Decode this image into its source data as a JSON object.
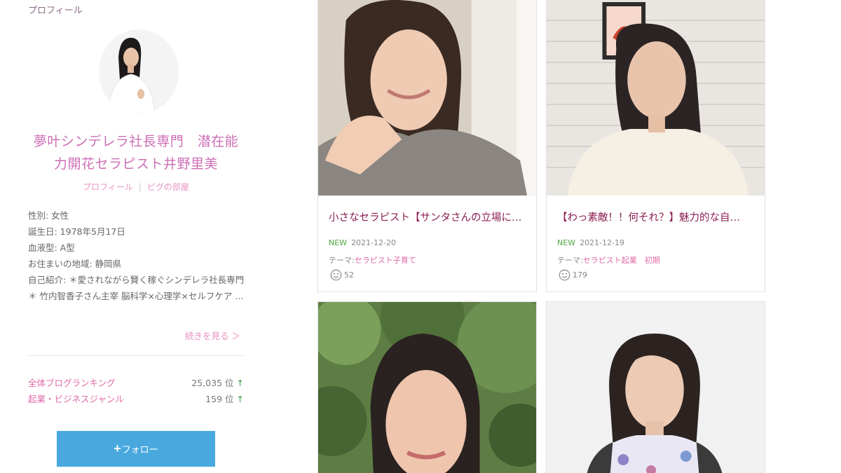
{
  "profile": {
    "heading": "プロフィール",
    "blog_title": "夢叶シンデレラ社長専門　潜在能力開花セラピスト井野里美",
    "links": [
      "プロフィール",
      "ピグの部屋"
    ],
    "separator": "|",
    "details": {
      "gender": "性別: 女性",
      "birthday": "誕生日: 1978年5月17日",
      "blood": "血液型: A型",
      "location": "お住まいの地域: 静岡県",
      "intro": "自己紹介: ＊愛されながら賢く稼ぐシンデレラ社長専門＊ 竹内智香子さん主宰 脳科学×心理学×セルフケア ..."
    },
    "more_label": "続きを見る ＞",
    "rankings": [
      {
        "name": "全体ブログランキング",
        "value": "25,035 位",
        "arrow": "↑"
      },
      {
        "name": "起業・ビジネスジャンル",
        "value": "159 位",
        "arrow": "↑"
      }
    ],
    "follow": {
      "plus": "+",
      "label": "フォロー"
    }
  },
  "cards": [
    {
      "title": "小さなセラピスト【サンタさんの立場に…",
      "new_label": "NEW",
      "date": "2021-12-20",
      "theme_label": "テーマ:",
      "theme": "セラピスト子育て",
      "likes": "52"
    },
    {
      "title": "【わっ素敵！！何それ？】魅力的な自…",
      "new_label": "NEW",
      "date": "2021-12-19",
      "theme_label": "テーマ:",
      "theme": "セラピスト起業　初期",
      "likes": "179"
    }
  ],
  "colors": {
    "title_pink": "#cc6fb5",
    "link_pink": "#e06aa8",
    "card_title": "#8b1d52",
    "new_green": "#52a843",
    "follow_blue": "#49a9df"
  }
}
